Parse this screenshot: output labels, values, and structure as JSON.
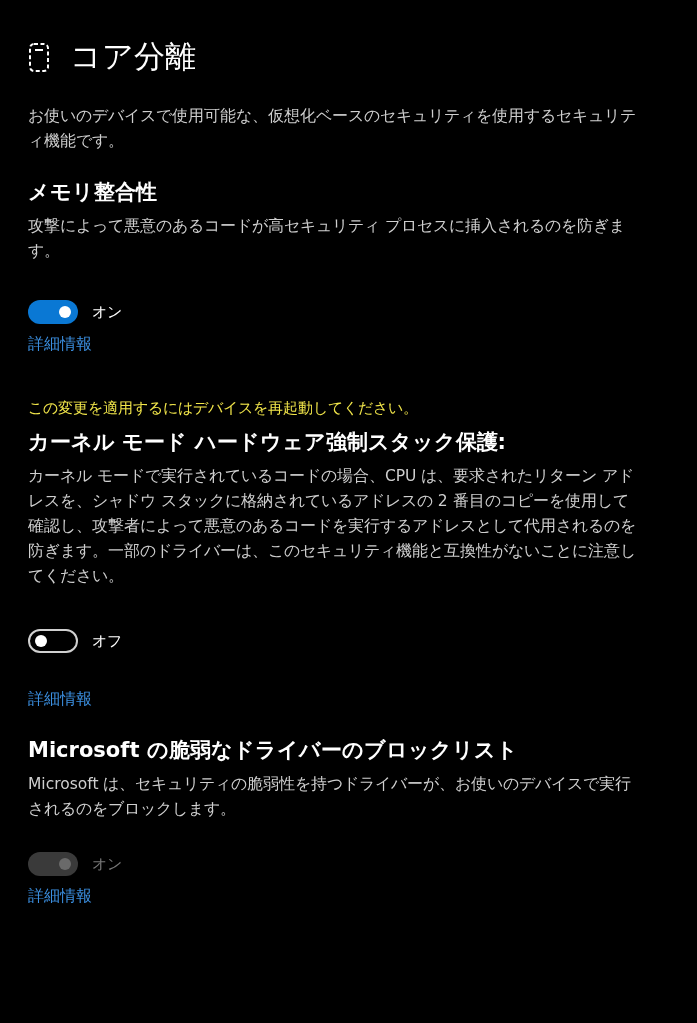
{
  "page": {
    "title": "コア分離",
    "description": "お使いのデバイスで使用可能な、仮想化ベースのセキュリティを使用するセキュリティ機能です。"
  },
  "sections": [
    {
      "title": "メモリ整合性",
      "description": "攻撃によって悪意のあるコードが高セキュリティ プロセスに挿入されるのを防ぎます。",
      "toggle": {
        "on": true,
        "disabled": false,
        "label": "オン"
      },
      "link": "詳細情報"
    },
    {
      "notice": "この変更を適用するにはデバイスを再起動してください。",
      "title": "カーネル モード ハードウェア強制スタック保護:",
      "description": "カーネル モードで実行されているコードの場合、CPU は、要求されたリターン アドレスを、シャドウ スタックに格納されているアドレスの 2 番目のコピーを使用して確認し、攻撃者によって悪意のあるコードを実行するアドレスとして代用されるのを防ぎます。一部のドライバーは、このセキュリティ機能と互換性がないことに注意してください。",
      "toggle": {
        "on": false,
        "disabled": false,
        "label": "オフ"
      },
      "link": "詳細情報"
    },
    {
      "title": "Microsoft の脆弱なドライバーのブロックリスト",
      "description": "Microsoft は、セキュリティの脆弱性を持つドライバーが、お使いのデバイスで実行されるのをブロックします。",
      "toggle": {
        "on": true,
        "disabled": true,
        "label": "オン"
      },
      "link": "詳細情報"
    }
  ]
}
